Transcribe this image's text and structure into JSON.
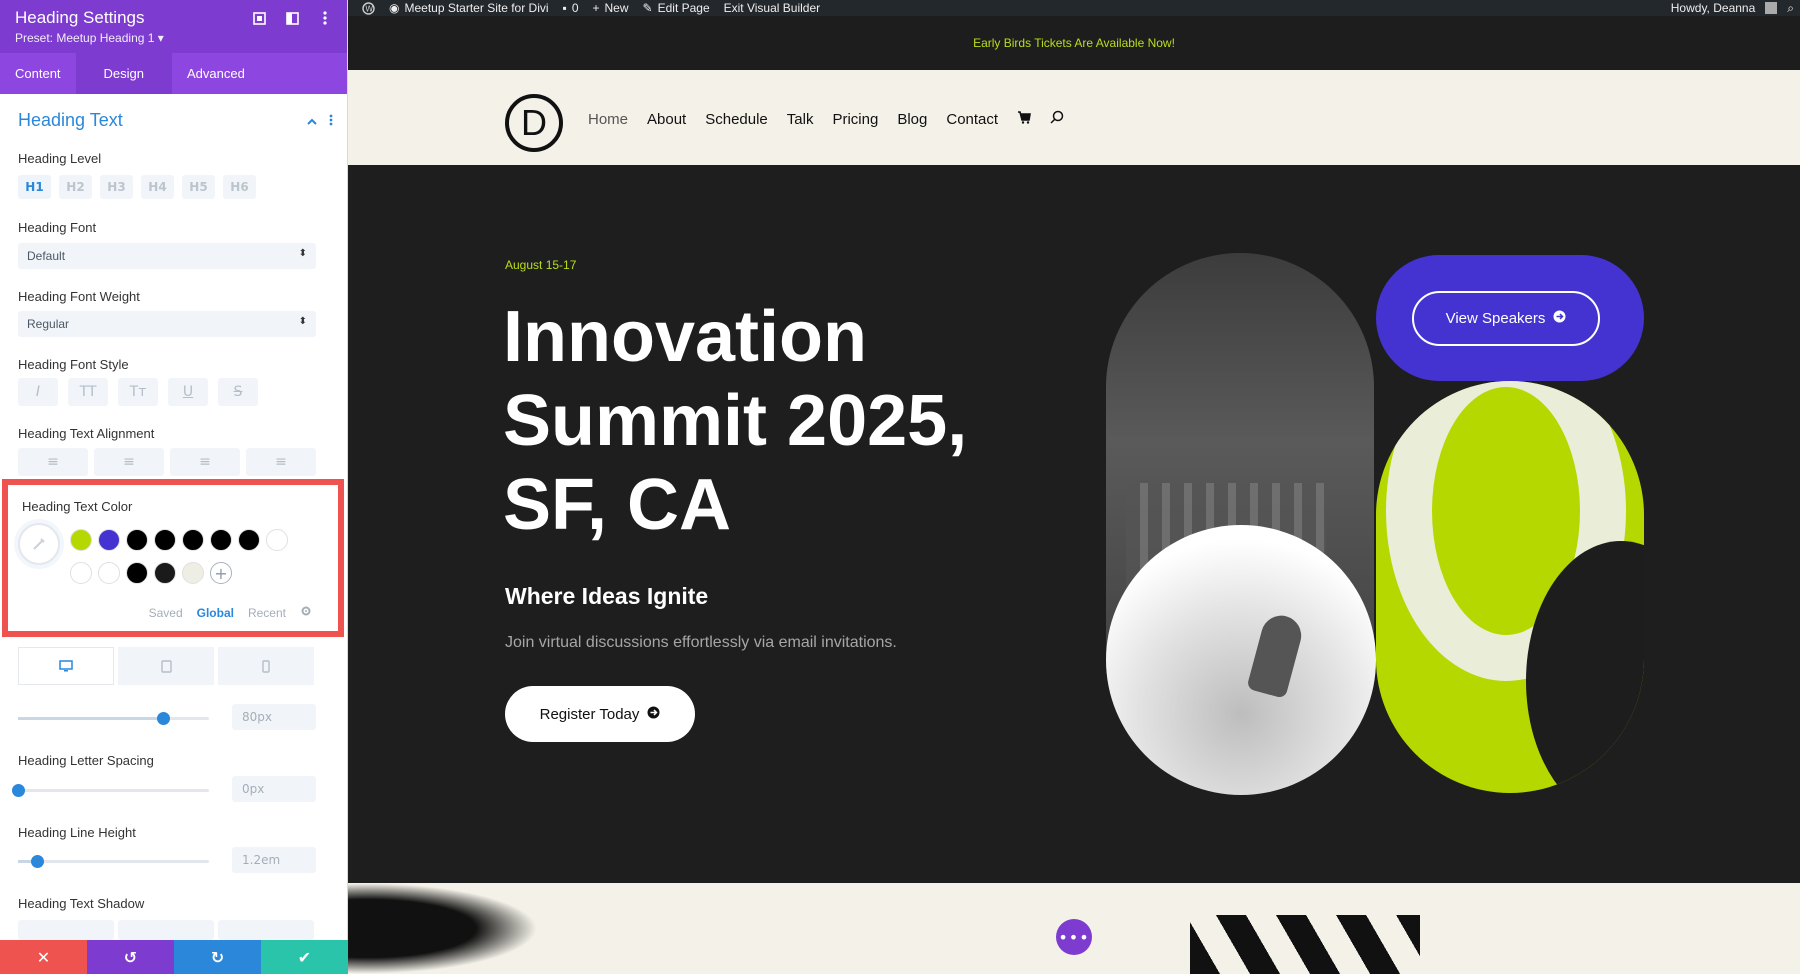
{
  "panel": {
    "title": "Heading Settings",
    "preset": "Preset: Meetup Heading 1 ▾",
    "tabs": [
      "Content",
      "Design",
      "Advanced"
    ],
    "active_tab": "Design",
    "section_title": "Heading Text",
    "heading_level": {
      "label": "Heading Level",
      "options": [
        "H1",
        "H2",
        "H3",
        "H4",
        "H5",
        "H6"
      ],
      "selected": "H1"
    },
    "heading_font": {
      "label": "Heading Font",
      "value": "Default"
    },
    "heading_font_weight": {
      "label": "Heading Font Weight",
      "value": "Regular"
    },
    "heading_font_style": {
      "label": "Heading Font Style",
      "options": [
        "I",
        "TT",
        "Tт",
        "U",
        "S"
      ]
    },
    "heading_text_alignment": {
      "label": "Heading Text Alignment"
    },
    "heading_text_color": {
      "label": "Heading Text Color",
      "swatches_row1": [
        "#b5d900",
        "#4433d1",
        "#000000",
        "#000000",
        "#000000",
        "#000000",
        "#000000",
        "#ffffff"
      ],
      "swatches_row2": [
        "#ffffff",
        "#ffffff",
        "#000000",
        "#1a1a1a",
        "#efeee4"
      ],
      "tabs": [
        "Saved",
        "Global",
        "Recent"
      ],
      "active_tab": "Global"
    },
    "heading_text_size": {
      "value": "80px",
      "percent": 0.76
    },
    "heading_letter_spacing": {
      "label": "Heading Letter Spacing",
      "value": "0px",
      "percent": 0.0
    },
    "heading_line_height": {
      "label": "Heading Line Height",
      "value": "1.2em",
      "percent": 0.1
    },
    "heading_text_shadow": {
      "label": "Heading Text Shadow"
    },
    "footer_colors": {
      "cancel": "#ef5350",
      "undo": "#7d3bcf",
      "redo": "#2b87da",
      "save": "#29c4a9"
    }
  },
  "adminbar": {
    "site": "Meetup Starter Site for Divi",
    "comments": "0",
    "new": "New",
    "edit": "Edit Page",
    "exit": "Exit Visual Builder",
    "howdy": "Howdy, Deanna"
  },
  "site": {
    "banner": "Early Birds Tickets Are Available Now!",
    "logo": "D",
    "nav": [
      "Home",
      "About",
      "Schedule",
      "Talk",
      "Pricing",
      "Blog",
      "Contact"
    ],
    "date": "August 15-17",
    "title": "Innovation Summit 2025, SF, CA",
    "subtitle": "Where Ideas Ignite",
    "description": "Join virtual discussions effortlessly via email invitations.",
    "register": "Register Today",
    "speakers": "View Speakers"
  },
  "colors": {
    "purple": "#7d3bcf",
    "accent": "#2b87da",
    "lime": "#b5d900",
    "indigo": "#4433d1",
    "dark": "#1e1e1e",
    "cream": "#f3f1e8"
  }
}
